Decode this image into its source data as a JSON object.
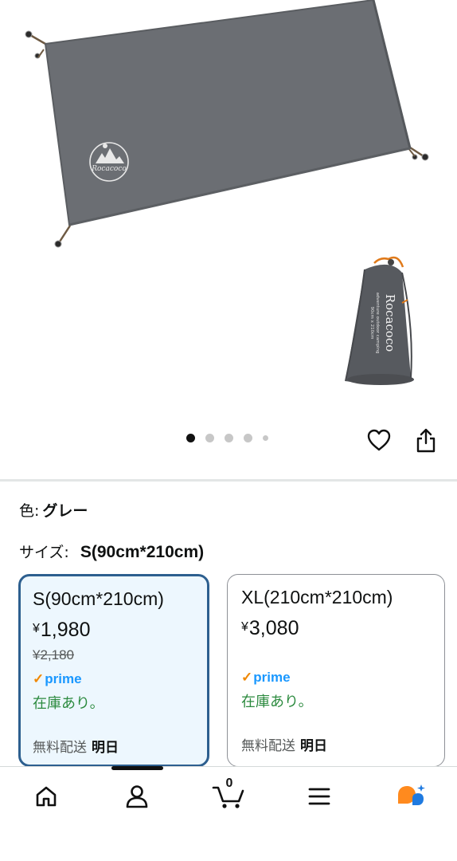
{
  "product_images": {
    "main_brand_logo": "Rocacoco",
    "bag_brand_text": "Rocacoco",
    "bag_subtext_line1": "adventure outdoor camping",
    "bag_subtext_line2": "90cm x 210cm"
  },
  "carousel": {
    "dot_count": 5,
    "active_index": 0
  },
  "actions": {
    "wishlist_icon": "heart-icon",
    "share_icon": "share-icon"
  },
  "variation": {
    "color_label": "色:",
    "color_value": "グレー",
    "size_label": "サイズ:",
    "size_value": "S(90cm*210cm)"
  },
  "options": [
    {
      "title": "S(90cm*210cm)",
      "currency": "¥",
      "price": "1,980",
      "old_price": "¥2,180",
      "prime_label": "prime",
      "stock": "在庫あり。",
      "delivery_label": "無料配送",
      "delivery_day": "明日",
      "selected": true
    },
    {
      "title": "XL(210cm*210cm)",
      "currency": "¥",
      "price": "3,080",
      "prime_label": "prime",
      "stock": "在庫あり。",
      "delivery_label": "無料配送",
      "delivery_day": "明日",
      "selected": false
    }
  ],
  "bottom_nav": {
    "items": [
      "home-icon",
      "account-icon",
      "cart-icon",
      "menu-icon",
      "rufus-assistant-icon"
    ],
    "cart_count": "0"
  },
  "colors": {
    "selected_border": "#2d5f8f",
    "selected_bg": "#edf7fe",
    "prime_blue": "#1a98ff",
    "prime_check": "#f08804",
    "in_stock_green": "#2b8a3e",
    "tarp_gray": "#6b6e73"
  }
}
